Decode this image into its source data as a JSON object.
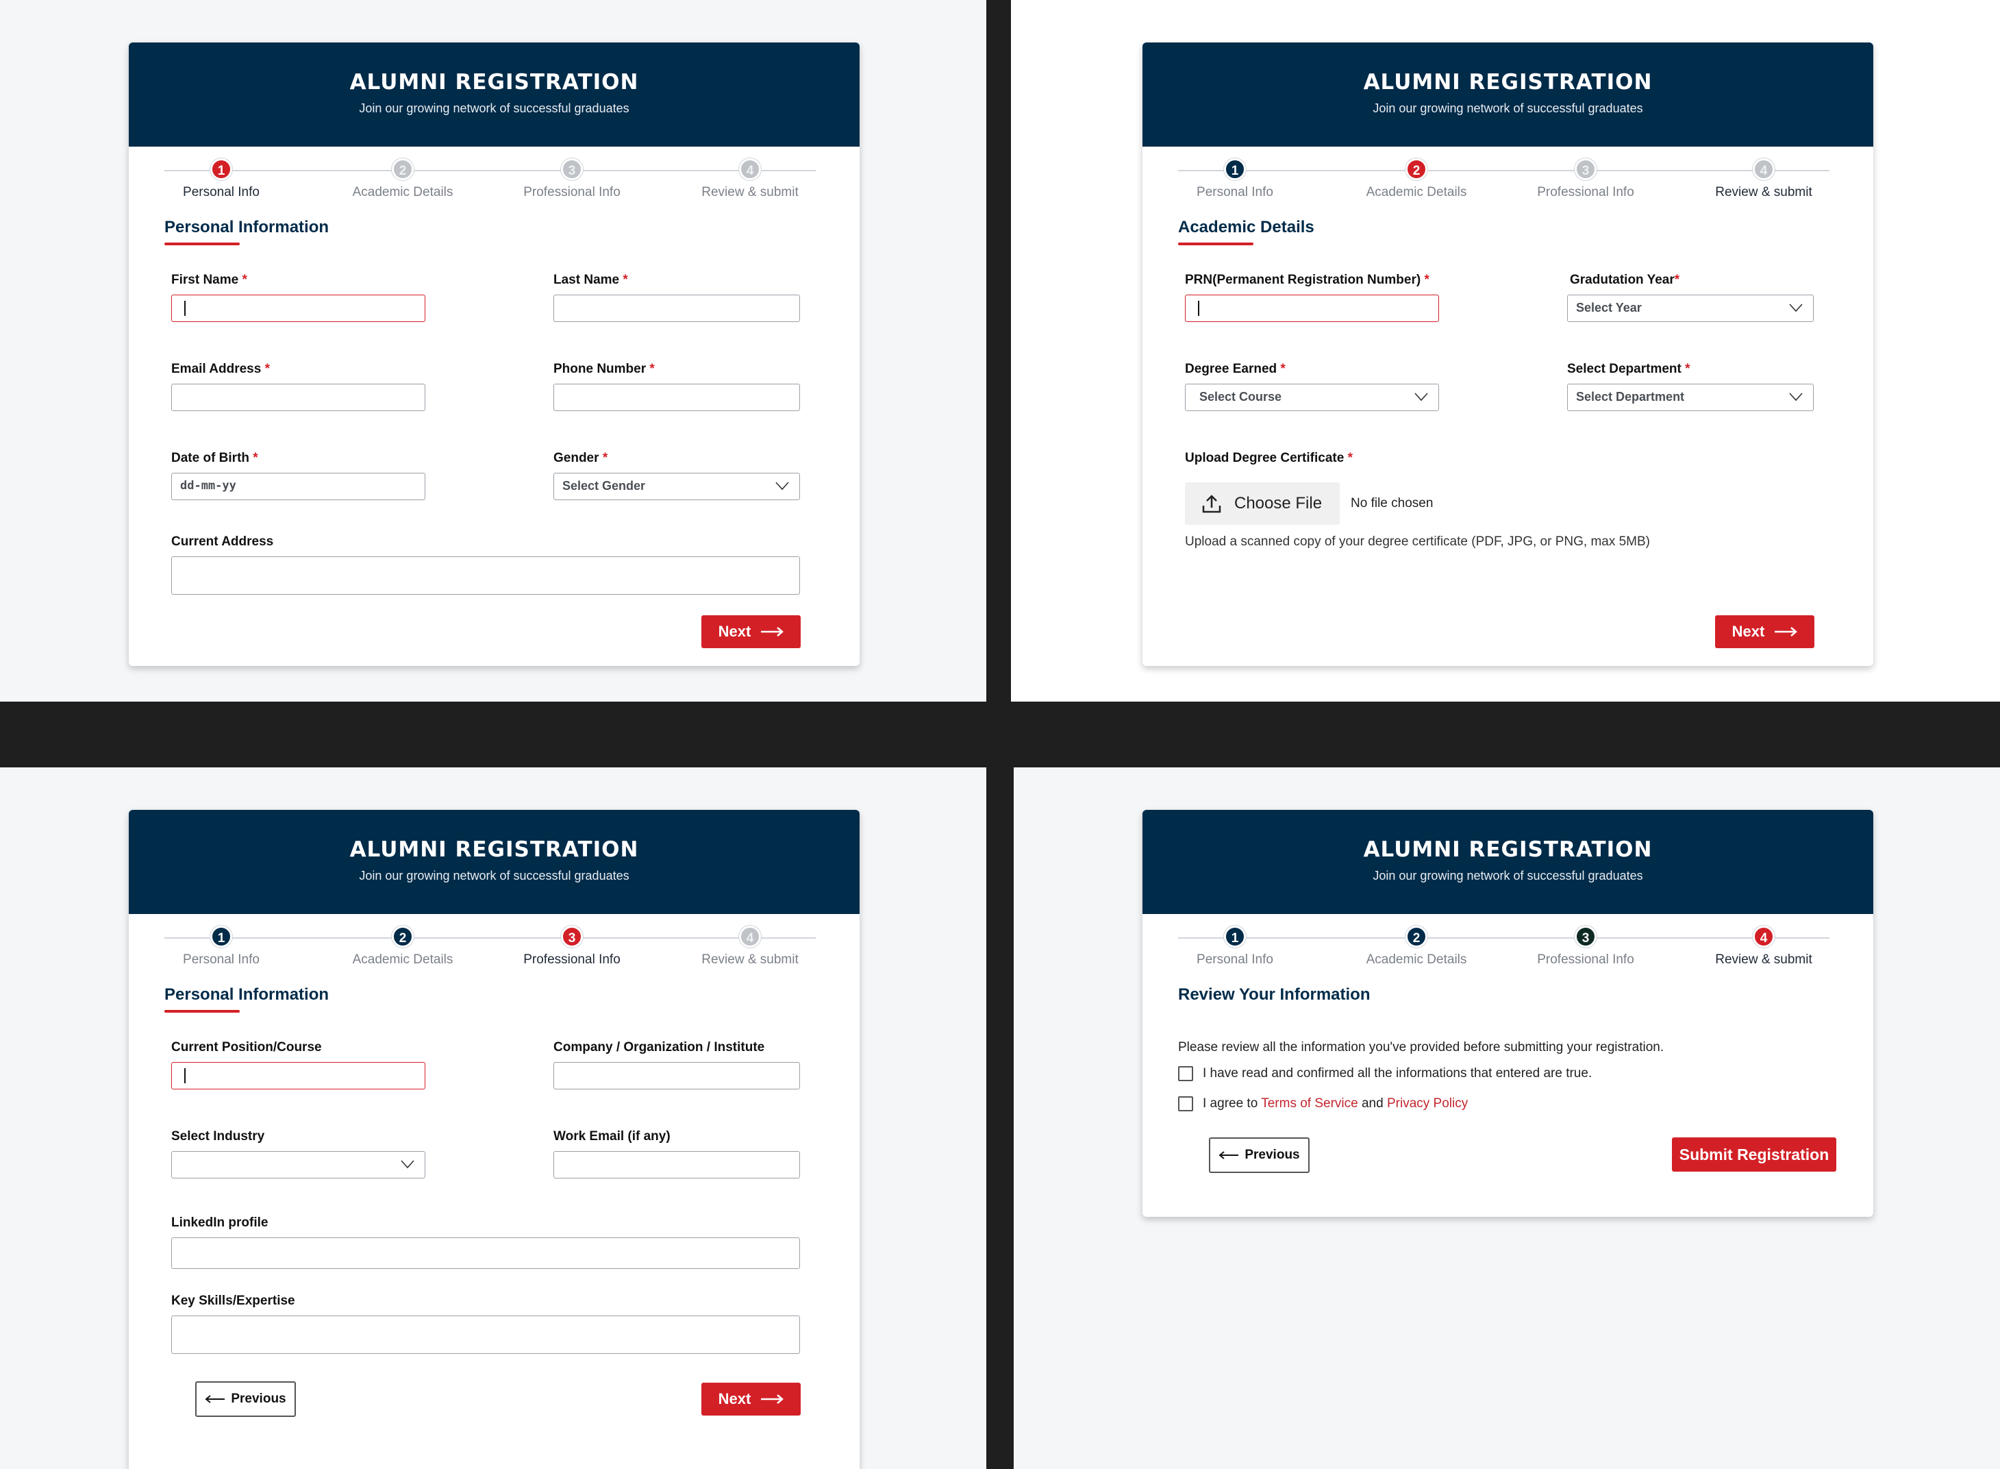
{
  "header": {
    "title": "ALUMNI REGISTRATION",
    "subtitle": "Join our growing network of successful graduates"
  },
  "steps": [
    {
      "num": "1",
      "label": "Personal Info"
    },
    {
      "num": "2",
      "label": "Academic Details"
    },
    {
      "num": "3",
      "label": "Professional Info"
    },
    {
      "num": "4",
      "label": "Review & submit"
    }
  ],
  "required_mark": "*",
  "colors": {
    "navy": "#002b49",
    "accent_red": "#d32027",
    "pending_grey": "#bfc3c8"
  },
  "personal": {
    "section_title": "Personal Information",
    "first_name": "First Name",
    "last_name": "Last Name",
    "email": "Email Address",
    "phone": "Phone Number",
    "dob": "Date of Birth",
    "dob_placeholder": "dd-mm-yy",
    "gender": "Gender",
    "gender_placeholder": "Select Gender",
    "address": "Current Address",
    "next": "Next"
  },
  "academic": {
    "section_title": "Academic Details",
    "prn": "PRN(Permanent Registration Number)",
    "grad_year": "Gradutation Year",
    "grad_year_placeholder": "Select Year",
    "degree": "Degree Earned",
    "degree_placeholder": "Select Course",
    "department": "Select Department",
    "department_placeholder": "Select Department",
    "upload_label": "Upload Degree Certificate",
    "choose_file": "Choose File",
    "no_file": "No file chosen",
    "upload_hint": "Upload a scanned copy of your degree certificate (PDF, JPG, or PNG, max 5MB)",
    "next": "Next"
  },
  "professional": {
    "section_title": "Personal Information",
    "position": "Current Position/Course",
    "company": "Company / Organization / Institute",
    "industry": "Select Industry",
    "work_email": "Work Email (if any)",
    "linkedin": "LinkedIn profile",
    "skills": "Key Skills/Expertise",
    "previous": "Previous",
    "next": "Next"
  },
  "review": {
    "section_title": "Review Your Information",
    "intro": "Please review all the information you've provided before submitting your registration.",
    "confirm": "I have read and confirmed all the informations that entered are true.",
    "agree_prefix": "I agree to",
    "terms": "Terms of Service",
    "and": "and",
    "privacy": "Privacy Policy",
    "previous": "Previous",
    "submit": "Submit Registration"
  }
}
